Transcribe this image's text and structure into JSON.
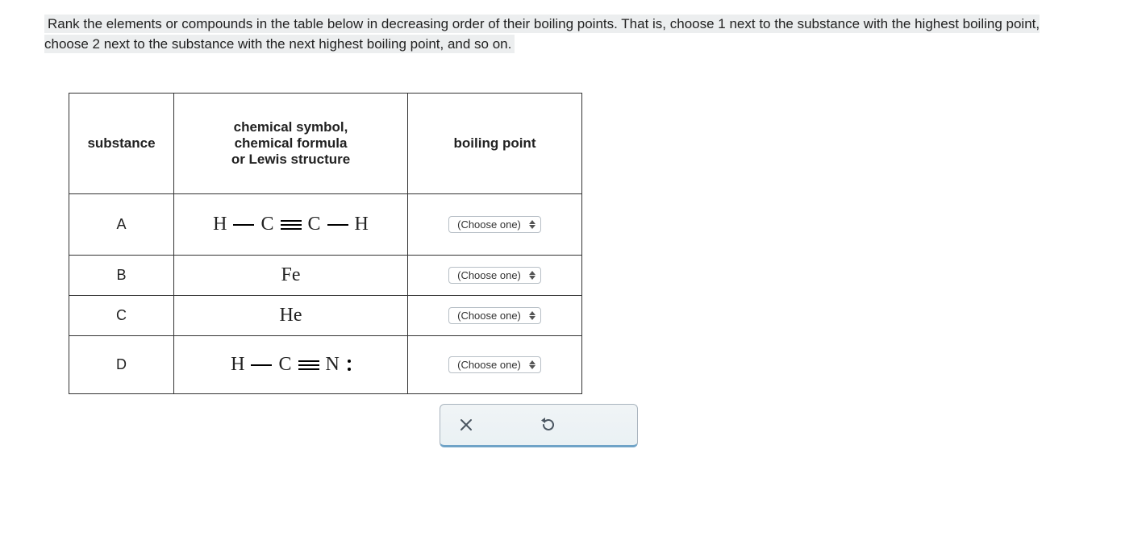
{
  "question": "Rank the elements or compounds in the table below in decreasing order of their boiling points. That is, choose 1 next to the substance with the highest boiling point, choose 2 next to the substance with the next highest boiling point, and so on.",
  "headers": {
    "c1": "substance",
    "c2": "chemical symbol,\nchemical formula\nor Lewis structure",
    "c3": "boiling point"
  },
  "rows": {
    "a": {
      "sub": "A",
      "formula_type": "acetylene",
      "atoms": [
        "H",
        "C",
        "C",
        "H"
      ]
    },
    "b": {
      "sub": "B",
      "formula_text": "Fe"
    },
    "c": {
      "sub": "C",
      "formula_text": "He"
    },
    "d": {
      "sub": "D",
      "formula_type": "hcn",
      "atoms": [
        "H",
        "C",
        "N"
      ]
    }
  },
  "select_placeholder": "(Choose one)",
  "icons": {
    "close": "close-icon",
    "reset": "reset-icon",
    "chevrons": "chevron-updown-icon"
  }
}
